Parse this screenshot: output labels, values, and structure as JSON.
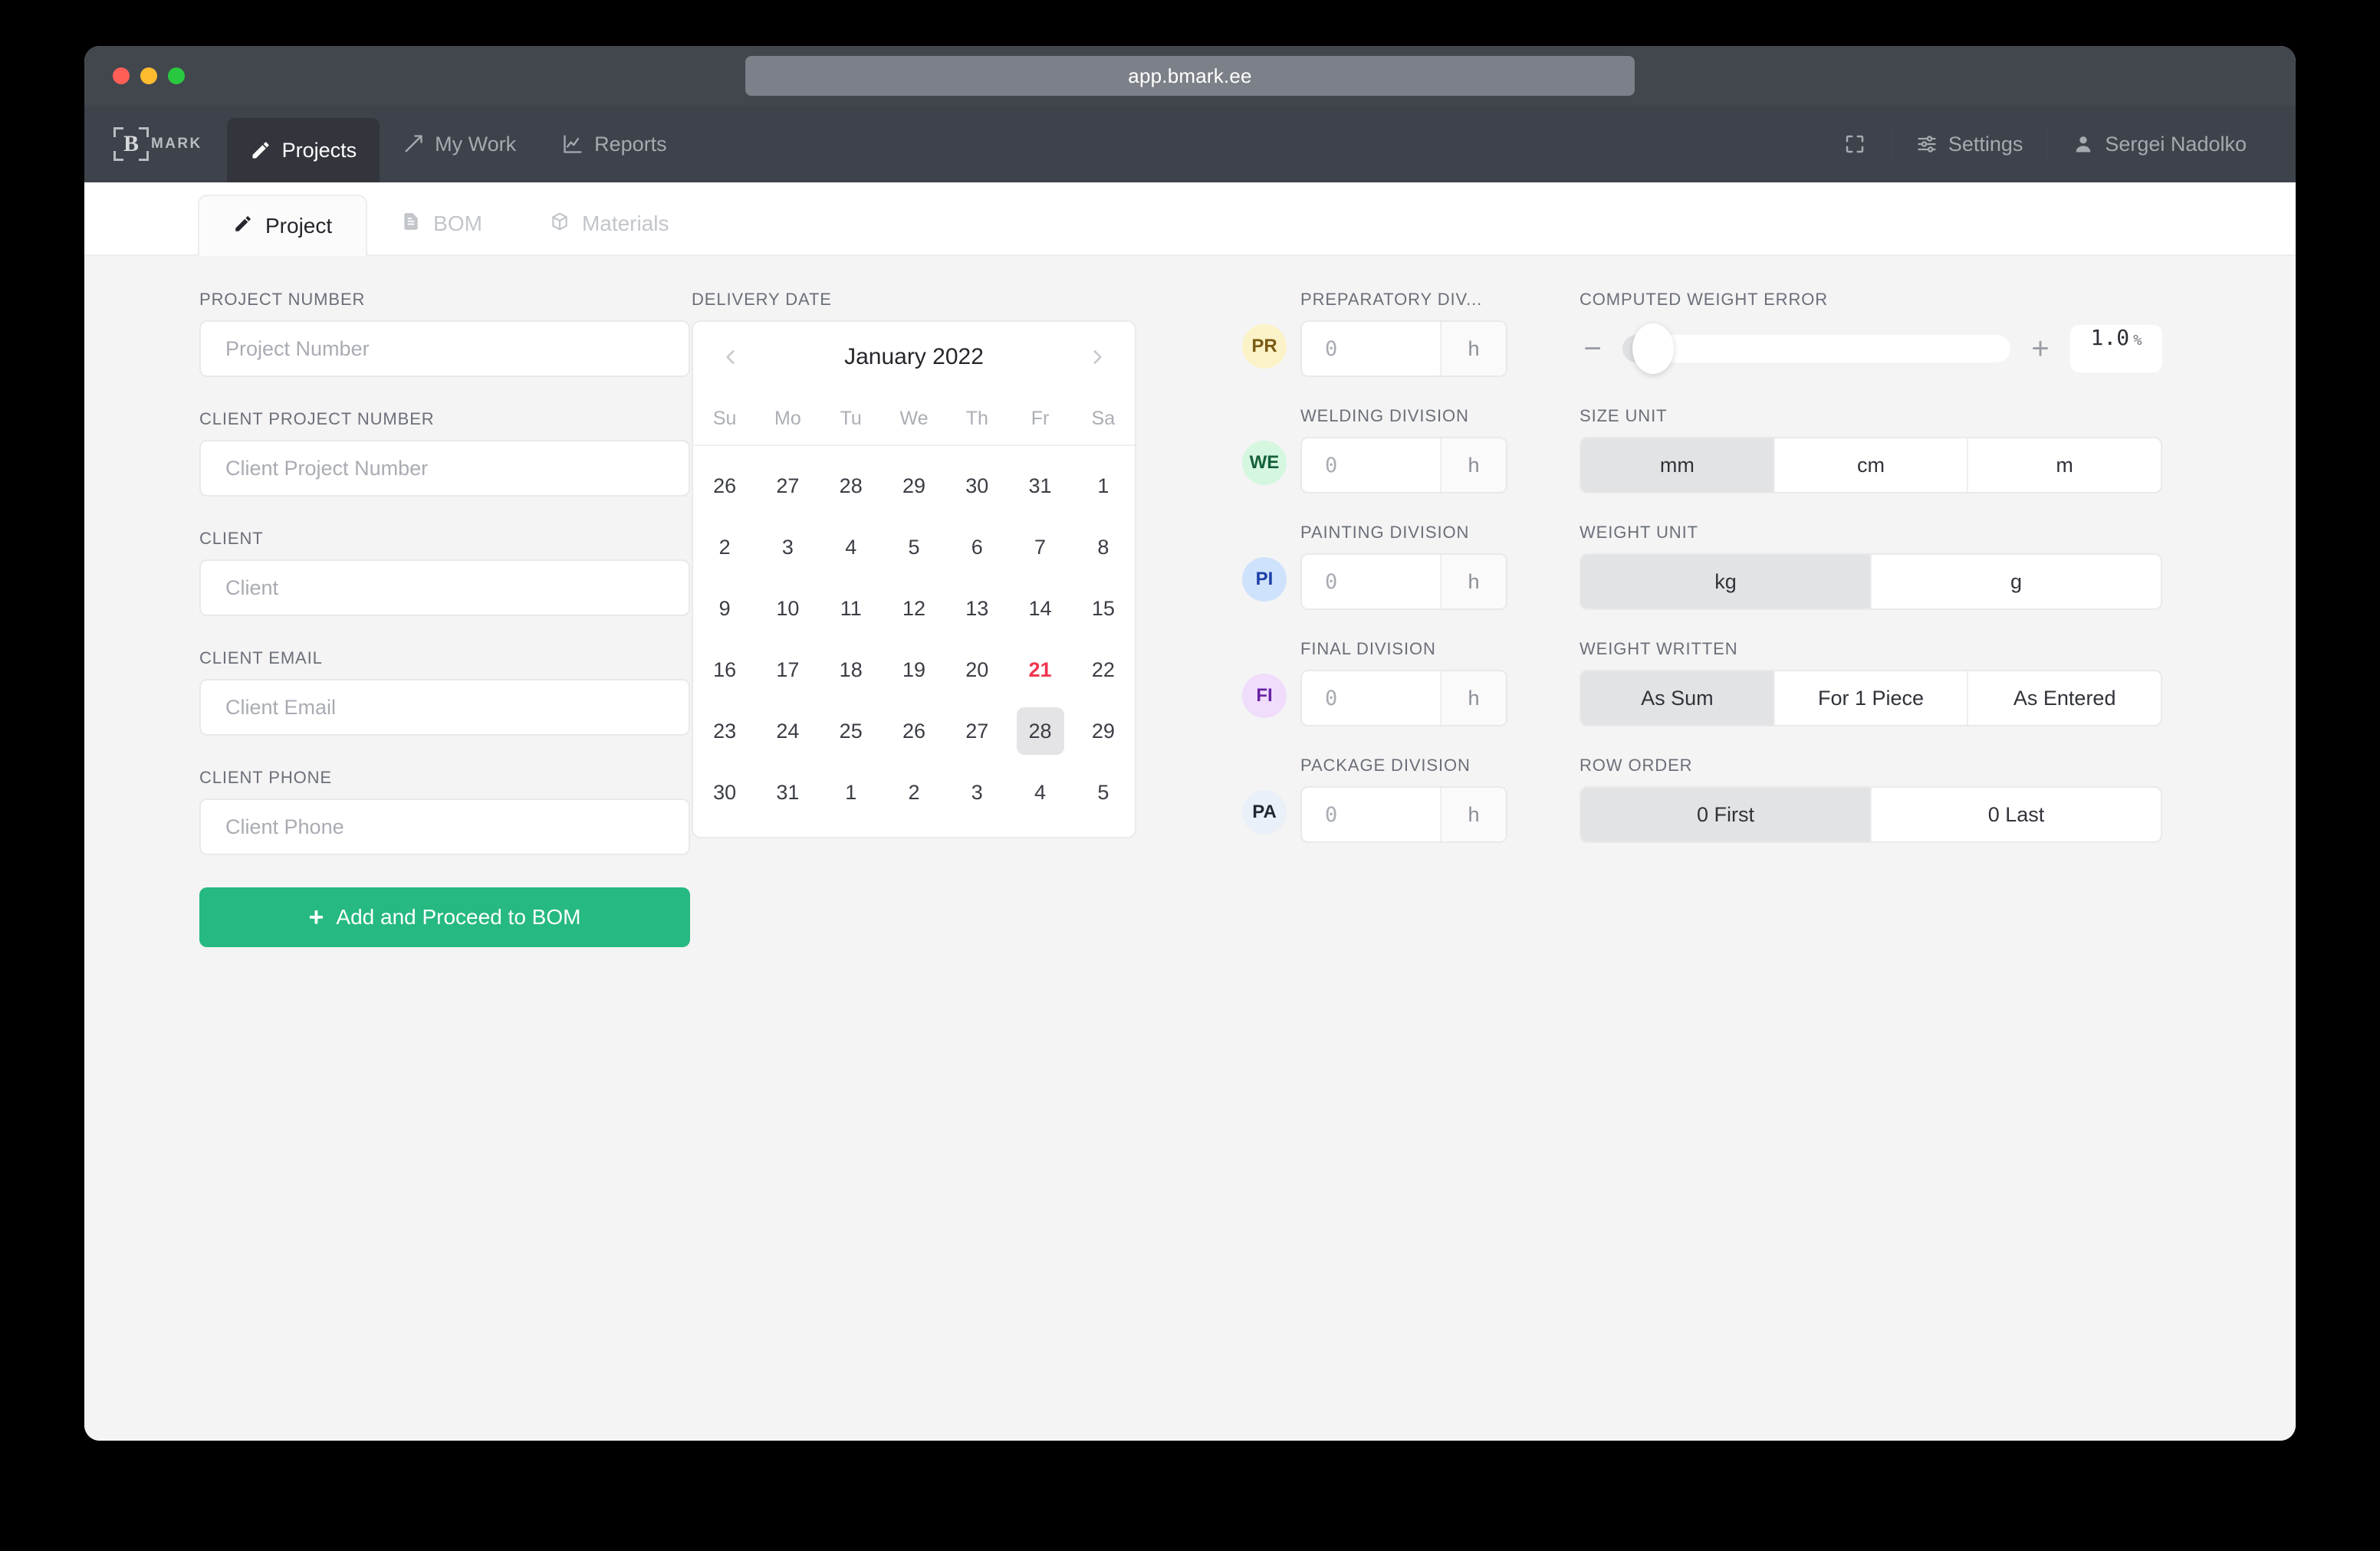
{
  "browser": {
    "url": "app.bmark.ee"
  },
  "nav": {
    "brand_letter": "B",
    "brand_text": "MARK",
    "items": [
      {
        "label": "Projects",
        "icon": "pencil-icon",
        "active": true
      },
      {
        "label": "My Work",
        "icon": "hammer-icon",
        "active": false
      },
      {
        "label": "Reports",
        "icon": "chart-line-icon",
        "active": false
      }
    ],
    "fullscreen_icon": "fullscreen-icon",
    "settings_label": "Settings",
    "user_label": "Sergei Nadolko"
  },
  "tabs": [
    {
      "label": "Project",
      "icon": "pencil-icon",
      "active": true
    },
    {
      "label": "BOM",
      "icon": "document-icon",
      "active": false
    },
    {
      "label": "Materials",
      "icon": "cube-icon",
      "active": false
    }
  ],
  "form": {
    "fields": [
      {
        "label": "PROJECT NUMBER",
        "placeholder": "Project Number",
        "value": ""
      },
      {
        "label": "CLIENT PROJECT NUMBER",
        "placeholder": "Client Project Number",
        "value": ""
      },
      {
        "label": "CLIENT",
        "placeholder": "Client",
        "value": ""
      },
      {
        "label": "CLIENT EMAIL",
        "placeholder": "Client Email",
        "value": ""
      },
      {
        "label": "CLIENT PHONE",
        "placeholder": "Client Phone",
        "value": ""
      }
    ],
    "submit_label": "Add and Proceed to BOM"
  },
  "calendar": {
    "label": "DELIVERY DATE",
    "month_title": "January 2022",
    "prev_icon": "chevron-left-icon",
    "next_icon": "chevron-right-icon",
    "weekdays": [
      "Su",
      "Mo",
      "Tu",
      "We",
      "Th",
      "Fr",
      "Sa"
    ],
    "today": 21,
    "selected": 28,
    "weeks": [
      [
        {
          "d": "26",
          "out": true
        },
        {
          "d": "27",
          "out": true
        },
        {
          "d": "28",
          "out": true
        },
        {
          "d": "29",
          "out": true
        },
        {
          "d": "30",
          "out": true
        },
        {
          "d": "31",
          "out": true
        },
        {
          "d": "1",
          "out": false
        }
      ],
      [
        {
          "d": "2"
        },
        {
          "d": "3"
        },
        {
          "d": "4"
        },
        {
          "d": "5"
        },
        {
          "d": "6"
        },
        {
          "d": "7"
        },
        {
          "d": "8"
        }
      ],
      [
        {
          "d": "9"
        },
        {
          "d": "10"
        },
        {
          "d": "11"
        },
        {
          "d": "12"
        },
        {
          "d": "13"
        },
        {
          "d": "14"
        },
        {
          "d": "15"
        }
      ],
      [
        {
          "d": "16"
        },
        {
          "d": "17"
        },
        {
          "d": "18"
        },
        {
          "d": "19"
        },
        {
          "d": "20"
        },
        {
          "d": "21",
          "today": true
        },
        {
          "d": "22"
        }
      ],
      [
        {
          "d": "23"
        },
        {
          "d": "24"
        },
        {
          "d": "25"
        },
        {
          "d": "26"
        },
        {
          "d": "27"
        },
        {
          "d": "28",
          "selected": true
        },
        {
          "d": "29"
        }
      ],
      [
        {
          "d": "30"
        },
        {
          "d": "31"
        },
        {
          "d": "1",
          "out": true
        },
        {
          "d": "2",
          "out": true
        },
        {
          "d": "3",
          "out": true
        },
        {
          "d": "4",
          "out": true
        },
        {
          "d": "5",
          "out": true
        }
      ]
    ]
  },
  "divisions": [
    {
      "label": "PREPARATORY DIV...",
      "badge": "PR",
      "value": "",
      "placeholder": "0",
      "unit": "h",
      "bg": "#fcf2c8",
      "fg": "#7a5a13"
    },
    {
      "label": "WELDING DIVISION",
      "badge": "WE",
      "value": "",
      "placeholder": "0",
      "unit": "h",
      "bg": "#d5f7e0",
      "fg": "#14613a"
    },
    {
      "label": "PAINTING DIVISION",
      "badge": "PI",
      "value": "",
      "placeholder": "0",
      "unit": "h",
      "bg": "#cfe2fb",
      "fg": "#1c3fa8"
    },
    {
      "label": "FINAL DIVISION",
      "badge": "FI",
      "value": "",
      "placeholder": "0",
      "unit": "h",
      "bg": "#f0dcfb",
      "fg": "#6a23a6"
    },
    {
      "label": "PACKAGE DIVISION",
      "badge": "PA",
      "value": "",
      "placeholder": "0",
      "unit": "h",
      "bg": "#e9f0f8",
      "fg": "#1f2733"
    }
  ],
  "settings": {
    "weight_error": {
      "label": "COMPUTED WEIGHT ERROR",
      "minus": "−",
      "plus": "+",
      "value": "1.0",
      "unit": "%",
      "fill_percent": 8
    },
    "size_unit": {
      "label": "SIZE UNIT",
      "options": [
        "mm",
        "cm",
        "m"
      ],
      "selected": "mm"
    },
    "weight_unit": {
      "label": "WEIGHT UNIT",
      "options": [
        "kg",
        "g"
      ],
      "selected": "kg"
    },
    "weight_written": {
      "label": "WEIGHT WRITTEN",
      "options": [
        "As Sum",
        "For 1 Piece",
        "As Entered"
      ],
      "selected": "As Sum"
    },
    "row_order": {
      "label": "ROW ORDER",
      "options": [
        "0 First",
        "0 Last"
      ],
      "selected": "0 First"
    }
  }
}
